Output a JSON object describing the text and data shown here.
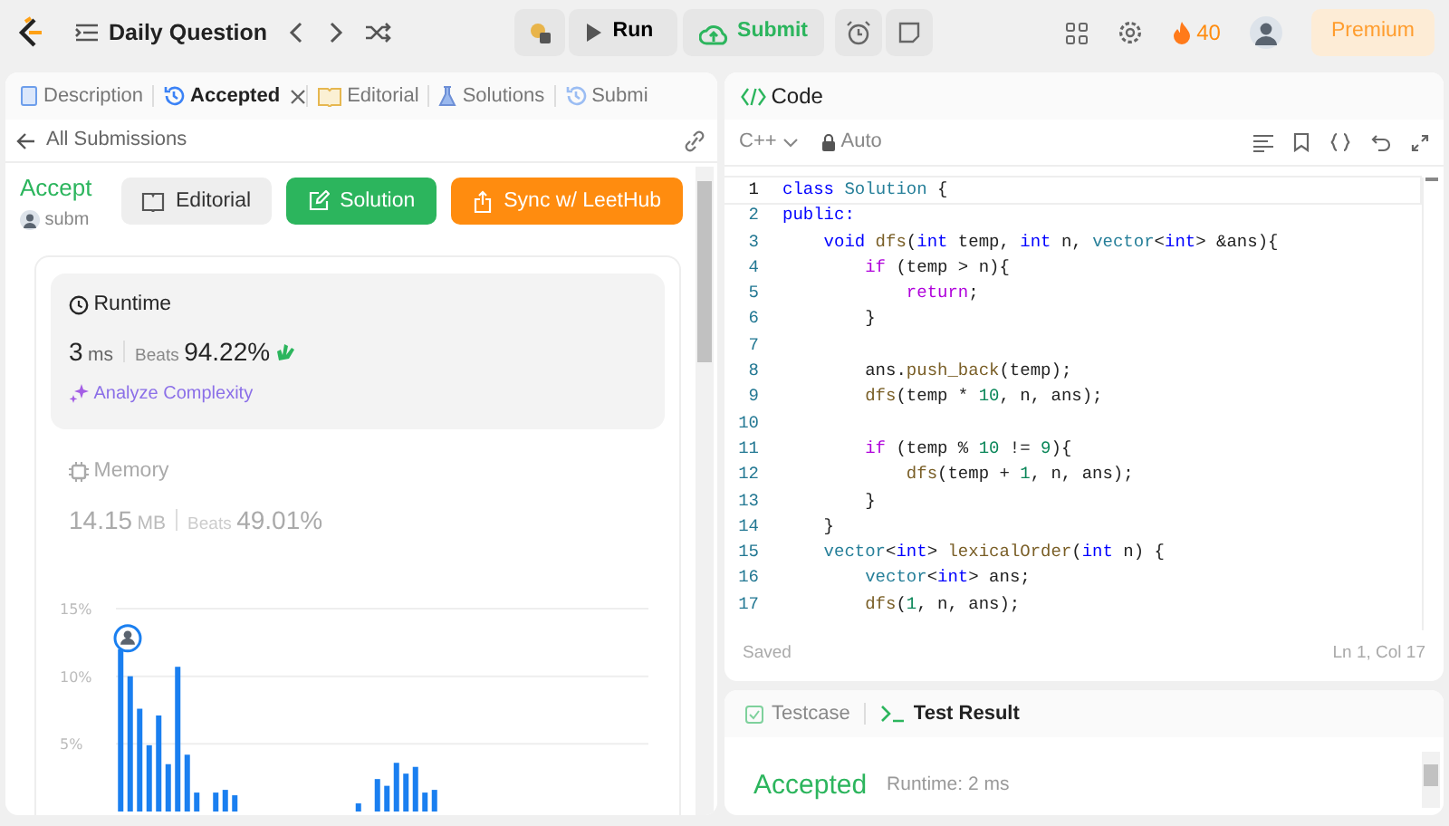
{
  "topbar": {
    "title": "Daily Question",
    "run": "Run",
    "submit": "Submit",
    "streak": "40",
    "premium": "Premium"
  },
  "left_tabs": [
    {
      "label": "Description",
      "selected": false,
      "closable": false
    },
    {
      "label": "Accepted",
      "selected": true,
      "closable": true
    },
    {
      "label": "Editorial",
      "selected": false,
      "closable": false
    },
    {
      "label": "Solutions",
      "selected": false,
      "closable": false
    },
    {
      "label": "Submi",
      "selected": false,
      "closable": false
    }
  ],
  "back_link": "All Submissions",
  "submission": {
    "status": "Accept",
    "author": "subm",
    "buttons": [
      {
        "label": "Editorial",
        "kind": "plain"
      },
      {
        "label": "Solution",
        "kind": "success"
      },
      {
        "label": "Sync w/ LeetHub",
        "kind": "warning"
      }
    ]
  },
  "metrics": [
    {
      "title": "Runtime",
      "value": "3",
      "unit": "ms",
      "beats_label": "Beats",
      "beats": "94.22%",
      "selected": true,
      "link": "Analyze Complexity"
    },
    {
      "title": "Memory",
      "value": "14.15",
      "unit": "MB",
      "beats_label": "Beats",
      "beats": "49.01%",
      "selected": false
    }
  ],
  "chart_data": {
    "type": "bar",
    "ylim": [
      0,
      15
    ],
    "yticks": [
      {
        "value": 5,
        "label": "5%"
      },
      {
        "value": 10,
        "label": "10%"
      },
      {
        "value": 15,
        "label": "15%"
      }
    ],
    "series": [
      {
        "color": "#1a7ff0",
        "values": [
          12,
          10,
          7.6,
          4.9,
          7.1,
          3.5,
          10.7,
          4.2,
          1.4,
          null,
          1.4,
          1.6,
          1.2,
          null,
          null,
          null,
          null,
          null,
          null,
          null,
          null,
          null,
          null,
          null,
          null,
          0.6,
          null,
          2.4,
          1.9,
          3.6,
          2.8,
          3.3,
          1.4,
          1.6,
          null,
          null,
          null,
          null,
          null,
          null,
          null,
          null,
          null,
          null,
          null,
          null,
          null,
          null,
          null,
          null,
          null,
          null,
          null,
          null,
          null,
          null
        ]
      }
    ]
  },
  "code_panel": {
    "title": "Code",
    "language": "C++",
    "mode": "Auto",
    "status": "Saved",
    "cursor": "Ln 1, Col 17",
    "lines": [
      {
        "number": "1",
        "tokens": [
          {
            "text": "class",
            "kind": "kw"
          },
          {
            "text": " Solution",
            "kind": "type"
          },
          {
            "text": " {",
            "kind": "plain"
          }
        ]
      },
      {
        "number": "2",
        "tokens": [
          {
            "text": "public:",
            "kind": "kw"
          }
        ]
      },
      {
        "number": "3",
        "tokens": [
          {
            "text": "    void",
            "kind": "kw"
          },
          {
            "text": " dfs",
            "kind": "fn"
          },
          {
            "text": "(",
            "kind": "plain"
          },
          {
            "text": "int",
            "kind": "kw"
          },
          {
            "text": " temp, ",
            "kind": "plain"
          },
          {
            "text": "int",
            "kind": "kw"
          },
          {
            "text": " n, ",
            "kind": "plain"
          },
          {
            "text": "vector",
            "kind": "type"
          },
          {
            "text": "<",
            "kind": "plain"
          },
          {
            "text": "int",
            "kind": "kw"
          },
          {
            "text": "> &ans){",
            "kind": "plain"
          }
        ]
      },
      {
        "number": "4",
        "tokens": [
          {
            "text": "        if",
            "kind": "ctl"
          },
          {
            "text": " (temp > n){",
            "kind": "plain"
          }
        ]
      },
      {
        "number": "5",
        "tokens": [
          {
            "text": "            return",
            "kind": "ctl"
          },
          {
            "text": ";",
            "kind": "plain"
          }
        ]
      },
      {
        "number": "6",
        "tokens": [
          {
            "text": "        }",
            "kind": "plain"
          }
        ]
      },
      {
        "number": "7"
      },
      {
        "number": "8",
        "tokens": [
          {
            "text": "        ans.",
            "kind": "plain"
          },
          {
            "text": "push_back",
            "kind": "fn"
          },
          {
            "text": "(temp);",
            "kind": "plain"
          }
        ]
      },
      {
        "number": "9",
        "tokens": [
          {
            "text": "        dfs",
            "kind": "fn"
          },
          {
            "text": "(temp * ",
            "kind": "plain"
          },
          {
            "text": "10",
            "kind": "num"
          },
          {
            "text": ", n, ans);",
            "kind": "plain"
          }
        ]
      },
      {
        "number": "10"
      },
      {
        "number": "11",
        "tokens": [
          {
            "text": "        if",
            "kind": "ctl"
          },
          {
            "text": " (temp % ",
            "kind": "plain"
          },
          {
            "text": "10",
            "kind": "num"
          },
          {
            "text": " != ",
            "kind": "plain"
          },
          {
            "text": "9",
            "kind": "num"
          },
          {
            "text": "){",
            "kind": "plain"
          }
        ]
      },
      {
        "number": "12",
        "tokens": [
          {
            "text": "            dfs",
            "kind": "fn"
          },
          {
            "text": "(temp + ",
            "kind": "plain"
          },
          {
            "text": "1",
            "kind": "num"
          },
          {
            "text": ", n, ans);",
            "kind": "plain"
          }
        ]
      },
      {
        "number": "13",
        "tokens": [
          {
            "text": "        }",
            "kind": "plain"
          }
        ]
      },
      {
        "number": "14",
        "tokens": [
          {
            "text": "    }",
            "kind": "plain"
          }
        ]
      },
      {
        "number": "15",
        "tokens": [
          {
            "text": "    vector",
            "kind": "type"
          },
          {
            "text": "<",
            "kind": "plain"
          },
          {
            "text": "int",
            "kind": "kw"
          },
          {
            "text": "> ",
            "kind": "plain"
          },
          {
            "text": "lexicalOrder",
            "kind": "fn"
          },
          {
            "text": "(",
            "kind": "plain"
          },
          {
            "text": "int",
            "kind": "kw"
          },
          {
            "text": " n) {",
            "kind": "plain"
          }
        ]
      },
      {
        "number": "16",
        "tokens": [
          {
            "text": "        vector",
            "kind": "type"
          },
          {
            "text": "<",
            "kind": "plain"
          },
          {
            "text": "int",
            "kind": "kw"
          },
          {
            "text": "> ans;",
            "kind": "plain"
          }
        ]
      },
      {
        "number": "17",
        "tokens": [
          {
            "text": "        dfs",
            "kind": "fn"
          },
          {
            "text": "(",
            "kind": "plain"
          },
          {
            "text": "1",
            "kind": "num"
          },
          {
            "text": ", n, ans);",
            "kind": "plain"
          }
        ]
      }
    ]
  },
  "result_panel": {
    "tabs": [
      {
        "label": "Testcase",
        "selected": false
      },
      {
        "label": "Test Result",
        "selected": true
      }
    ],
    "status": "Accepted",
    "runtime": "Runtime: 2 ms"
  }
}
